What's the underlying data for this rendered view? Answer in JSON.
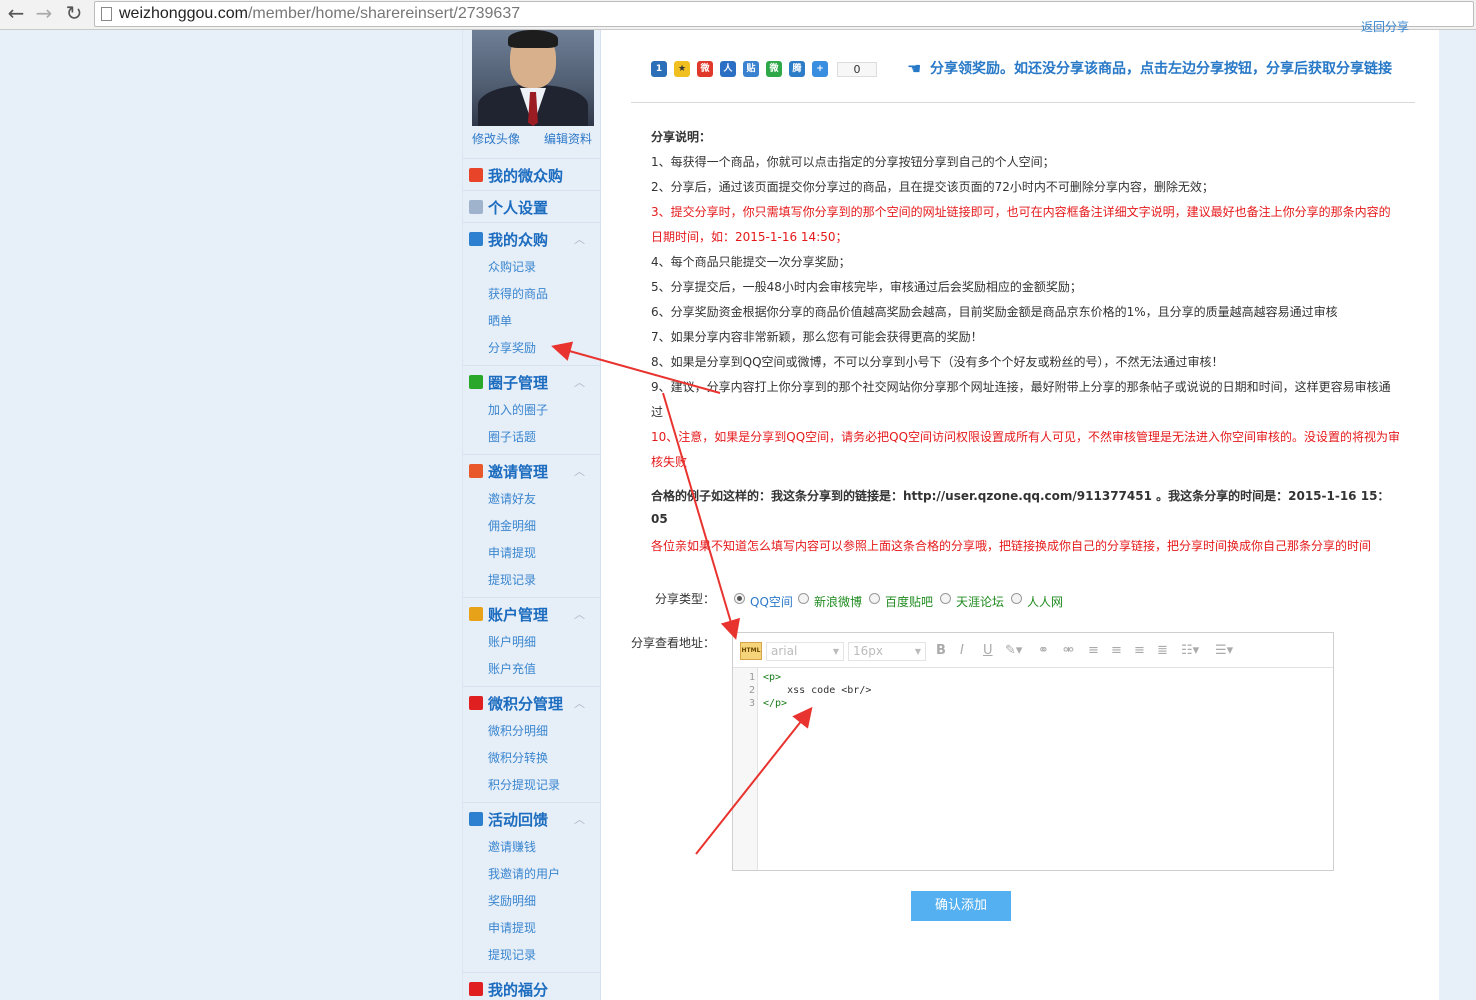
{
  "browser": {
    "url_domain": "weizhonggou.com",
    "url_path": "/member/home/sharereinsert/2739637"
  },
  "sidebar": {
    "avatar_links": [
      "修改头像",
      "编辑资料"
    ],
    "menu": [
      {
        "label": "我的微众购",
        "icon": "home-icon",
        "color": "#e8442a",
        "items": []
      },
      {
        "label": "个人设置",
        "icon": "gear-icon",
        "color": "#9fb4cc",
        "items": []
      },
      {
        "label": "我的众购",
        "icon": "cart-icon",
        "color": "#2d7fd0",
        "items": [
          "众购记录",
          "获得的商品",
          "晒单",
          "分享奖励"
        ]
      },
      {
        "label": "圈子管理",
        "icon": "circle-icon",
        "color": "#2aa82a",
        "items": [
          "加入的圈子",
          "圈子话题"
        ]
      },
      {
        "label": "邀请管理",
        "icon": "invite-icon",
        "color": "#e8582a",
        "items": [
          "邀请好友",
          "佣金明细",
          "申请提现",
          "提现记录"
        ]
      },
      {
        "label": "账户管理",
        "icon": "yen-icon",
        "color": "#e8a21a",
        "items": [
          "账户明细",
          "账户充值"
        ]
      },
      {
        "label": "微积分管理",
        "icon": "points-icon",
        "color": "#e02020",
        "items": [
          "微积分明细",
          "微积分转换",
          "积分提现记录"
        ]
      },
      {
        "label": "活动回馈",
        "icon": "activity-icon",
        "color": "#2d7fd0",
        "items": [
          "邀请赚钱",
          "我邀请的用户",
          "奖励明细",
          "申请提现",
          "提现记录"
        ]
      },
      {
        "label": "我的福分",
        "icon": "fortune-icon",
        "color": "#e02020",
        "items": []
      }
    ]
  },
  "main": {
    "top_link": "返回分享",
    "share_count": "0",
    "share_notice": "分享领奖励。如还没分享该商品，点击左边分享按钮，分享后获取分享链接",
    "instructions": [
      {
        "text": "分享说明：",
        "style": "bold"
      },
      {
        "text": "1、每获得一个商品，你就可以点击指定的分享按钮分享到自己的个人空间；",
        "style": "normal"
      },
      {
        "text": "2、分享后，通过该页面提交你分享过的商品，且在提交该页面的72小时内不可删除分享内容，删除无效；",
        "style": "normal"
      },
      {
        "text": "3、提交分享时，你只需填写你分享到的那个空间的网址链接即可，也可在内容框备注详细文字说明，建议最好也备注上你分享的那条内容的",
        "style": "red"
      },
      {
        "text": "日期时间，如：2015-1-16 14:50；",
        "style": "red"
      },
      {
        "text": "4、每个商品只能提交一次分享奖励；",
        "style": "normal"
      },
      {
        "text": "5、分享提交后，一般48小时内会审核完毕，审核通过后会奖励相应的金额奖励；",
        "style": "normal"
      },
      {
        "text": "6、分享奖励资金根据你分享的商品价值越高奖励会越高，目前奖励金额是商品京东价格的1%，且分享的质量越高越容易通过审核",
        "style": "normal"
      },
      {
        "text": "7、如果分享内容非常新颖，那么您有可能会获得更高的奖励！",
        "style": "normal"
      },
      {
        "text": "8、如果是分享到QQ空间或微博，不可以分享到小号下（没有多个个好友或粉丝的号），不然无法通过审核！",
        "style": "normal"
      },
      {
        "text": "9、建议，分享内容打上你分享到的那个社交网站你分享那个网址连接，最好附带上分享的那条帖子或说说的日期和时间，这样更容易审核通",
        "style": "normal"
      },
      {
        "text": "过",
        "style": "normal"
      },
      {
        "text": "10、注意，如果是分享到QQ空间，请务必把QQ空间访问权限设置成所有人可见，不然审核管理是无法进入你空间审核的。没设置的将视为审",
        "style": "red"
      },
      {
        "text": "核失败",
        "style": "red"
      },
      {
        "text": "合格的例子如这样的：我这条分享到的链接是：http://user.qzone.qq.com/911377451 。我这条分享的时间是：2015-1-16 15：",
        "style": "bold"
      },
      {
        "text": "05",
        "style": "bold"
      },
      {
        "text": "各位亲如果不知道怎么填写内容可以参照上面这条合格的分享哦，把链接换成你自己的分享链接，把分享时间换成你自己那条分享的时间",
        "style": "red"
      }
    ],
    "share_type_label": "分享类型：",
    "share_types": [
      {
        "label": "QQ空间",
        "checked": true
      },
      {
        "label": "新浪微博",
        "checked": false
      },
      {
        "label": "百度贴吧",
        "checked": false
      },
      {
        "label": "天涯论坛",
        "checked": false
      },
      {
        "label": "人人网",
        "checked": false
      }
    ],
    "view_url_label": "分享查看地址：",
    "editor": {
      "html_button": "HTML",
      "font_family": "arial",
      "font_size": "16px",
      "line_numbers": [
        "1",
        "2",
        "3"
      ],
      "code_lines": [
        "<p>",
        "    xss code <br/>",
        "</p>"
      ]
    },
    "submit_label": "确认添加"
  }
}
